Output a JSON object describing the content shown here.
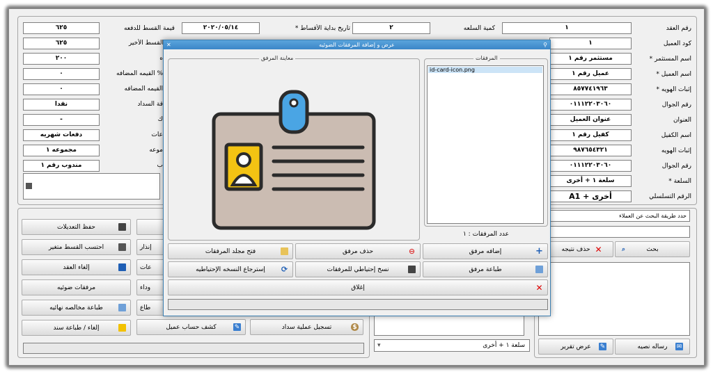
{
  "contract_fields": {
    "contract_no": {
      "label": "رقم العقد",
      "value": "١"
    },
    "client_code": {
      "label": "كود العميل",
      "value": "١"
    },
    "investor_name": {
      "label": "* اسم المستثمر",
      "value": "مستثمر رقم ١"
    },
    "client_name": {
      "label": "* اسم العميل",
      "value": "عميل رقم ١"
    },
    "id_proof": {
      "label": "* إثبات الهويه",
      "value": "٨٥٧٧٤١٩٦٣"
    },
    "mobile": {
      "label": "رقم الجوال",
      "value": "٠١١١٢٢٠٣٠٦٠"
    },
    "address": {
      "label": "العنوان",
      "value": "عنوان العميل"
    },
    "guarantor_name": {
      "label": "اسم الكفيل",
      "value": "كفيل رقم ١"
    },
    "guarantor_id": {
      "label": "إثبات الهويه",
      "value": "٩٨٧٦٥٤٣٢١"
    },
    "guarantor_mobile": {
      "label": "رقم الجوال",
      "value": "٠١١١٢٢٠٣٠٦٠"
    },
    "goods": {
      "label": "* السلعة",
      "value": "سلعة ١ + أخرى"
    },
    "serial": {
      "label": "الرقم التسلسلي",
      "value": "A1 + أخرى"
    }
  },
  "mid_fields": {
    "goods_qty": {
      "label": "كمية السلعه",
      "value": "١"
    },
    "start_date": {
      "label": "* تاريخ بداية الأقساط",
      "value": "٢"
    },
    "start_date_val": {
      "value": "٢٠٢٠/٠٥/١٤"
    },
    "installment_label": "قيمة القسط للدفعه",
    "last_installment_label": "القسط الأخير",
    "left_labels": [
      "ه",
      "القيمه المضافه %",
      "القيمه المضافه",
      "قة السداد",
      "ك",
      "عات",
      "موعه",
      "ب"
    ],
    "left_values": [
      "٦٢٥",
      "٦٢٥",
      "٢٠٠",
      "٠",
      "٠",
      "نقدا",
      "-",
      "دفعات شهريه",
      "مجموعه ١",
      "مندوب رقم ١"
    ]
  },
  "buttons_left": [
    {
      "label": "حفظ التعديلات",
      "icon": "save-icon"
    },
    {
      "label": "احتسب القسط متغير",
      "icon": "calendar-icon"
    },
    {
      "label": "إلغاء العقد",
      "icon": "warning-icon"
    },
    {
      "label": "مرفقات ضوئيه",
      "icon": "paperclip-icon"
    },
    {
      "label": "طباعة مخالصه نهائيه",
      "icon": "printer-icon"
    },
    {
      "label": "إلغاء / طباعة سند",
      "icon": "alert-print-icon"
    }
  ],
  "buttons_mid_partial": [
    "إنذار",
    "عات",
    "وداء",
    "طاع"
  ],
  "bottom_buttons": {
    "statement": "كشف حساب عميل",
    "payment": "تسجيل عملية سداد"
  },
  "search": {
    "method_label": "حدد طريقة البحث عن العملاء",
    "search_button": "بحث",
    "delete_result": "حذف نتيجه",
    "text_message": "رساله نصيه",
    "show_report": "عرض تقرير",
    "goods_combo": "سلعة ١ + أخرى"
  },
  "dialog": {
    "title": "عرض و إضافة المرفقات الضوئيه",
    "preview_title": "معاينة المرفق",
    "attachments_title": "المرفقات",
    "attachments": [
      "id-card-icon.png"
    ],
    "count_label": "عدد المرفقات : ١",
    "add": "إضافه مرفق",
    "delete": "حذف مرفق",
    "open_folder": "فتح مجلد المرفقات",
    "print": "طباعة مرفق",
    "backup": "نسخ إحتياطي للمرفقات",
    "restore": "إسترجاع النسخه الإحتياطيه",
    "close": "إغلاق"
  },
  "colors": {
    "title_bar": "#3b86c8",
    "selection": "#cce4f7"
  }
}
